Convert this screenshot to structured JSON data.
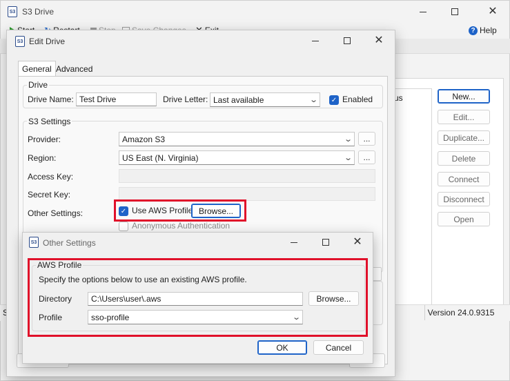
{
  "main_window": {
    "title": "S3 Drive",
    "app_icon_text": "S3",
    "toolbar": {
      "start": "Start",
      "restart": "Restart",
      "stop": "Stop",
      "save_changes": "Save Changes",
      "exit": "Exit",
      "help": "Help"
    },
    "list_partial_text": "us",
    "side_buttons": [
      "New...",
      "Edit...",
      "Duplicate...",
      "Delete",
      "Connect",
      "Disconnect",
      "Open"
    ],
    "status_left": "St",
    "version": "Version 24.0.9315"
  },
  "edit_drive": {
    "title": "Edit Drive",
    "tabs": [
      "General",
      "Advanced"
    ],
    "drive_group": {
      "label": "Drive",
      "drive_name_label": "Drive Name:",
      "drive_name_value": "Test Drive",
      "drive_letter_label": "Drive Letter:",
      "drive_letter_value": "Last available",
      "enabled_label": "Enabled",
      "enabled_checked": true
    },
    "s3_group": {
      "label": "S3 Settings",
      "provider_label": "Provider:",
      "provider_value": "Amazon S3",
      "region_label": "Region:",
      "region_value": "US East (N. Virginia)",
      "access_key_label": "Access Key:",
      "secret_key_label": "Secret Key:",
      "other_settings_label": "Other Settings:",
      "use_aws_profile_label": "Use AWS Profile",
      "use_aws_profile_checked": true,
      "browse_label": "Browse...",
      "anonymous_auth_label": "Anonymous Authentication",
      "ellipsis": "..."
    }
  },
  "other_settings": {
    "title": "Other Settings",
    "group_label": "AWS Profile",
    "description": "Specify the options below to use an existing AWS profile.",
    "directory_label": "Directory",
    "directory_value": "C:\\Users\\user\\.aws",
    "browse_label": "Browse...",
    "profile_label": "Profile",
    "profile_value": "sso-profile",
    "ok_label": "OK",
    "cancel_label": "Cancel"
  },
  "colors": {
    "accent": "#1e63c8",
    "highlight": "#e0102a",
    "window_bg": "#f0f0f0"
  }
}
